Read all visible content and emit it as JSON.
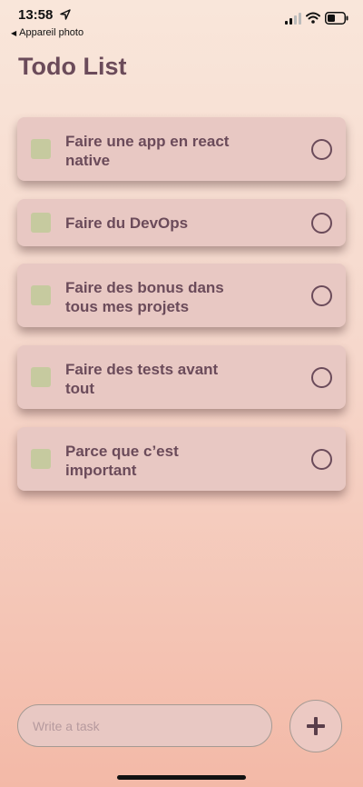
{
  "status_bar": {
    "time": "13:58",
    "back_app_label": "Appareil photo",
    "icons": [
      "location-icon",
      "signal-icon",
      "wifi-icon",
      "battery-icon"
    ]
  },
  "page": {
    "title": "Todo List"
  },
  "tasks": [
    {
      "text": "Faire une app en react native",
      "completed": false
    },
    {
      "text": "Faire du DevOps",
      "completed": false
    },
    {
      "text": "Faire des bonus dans tous mes projets",
      "completed": false
    },
    {
      "text": "Faire des tests avant tout",
      "completed": false
    },
    {
      "text": "Parce que c’est important",
      "completed": false
    }
  ],
  "composer": {
    "input_value": "",
    "input_placeholder": "Write a task",
    "add_button_label": "+"
  },
  "colors": {
    "card": "#e8c8c3",
    "square": "#c6ca9f",
    "text": "#6b4b5a",
    "background_top": "#f9e6da",
    "background_bottom": "#f3b9a7"
  }
}
